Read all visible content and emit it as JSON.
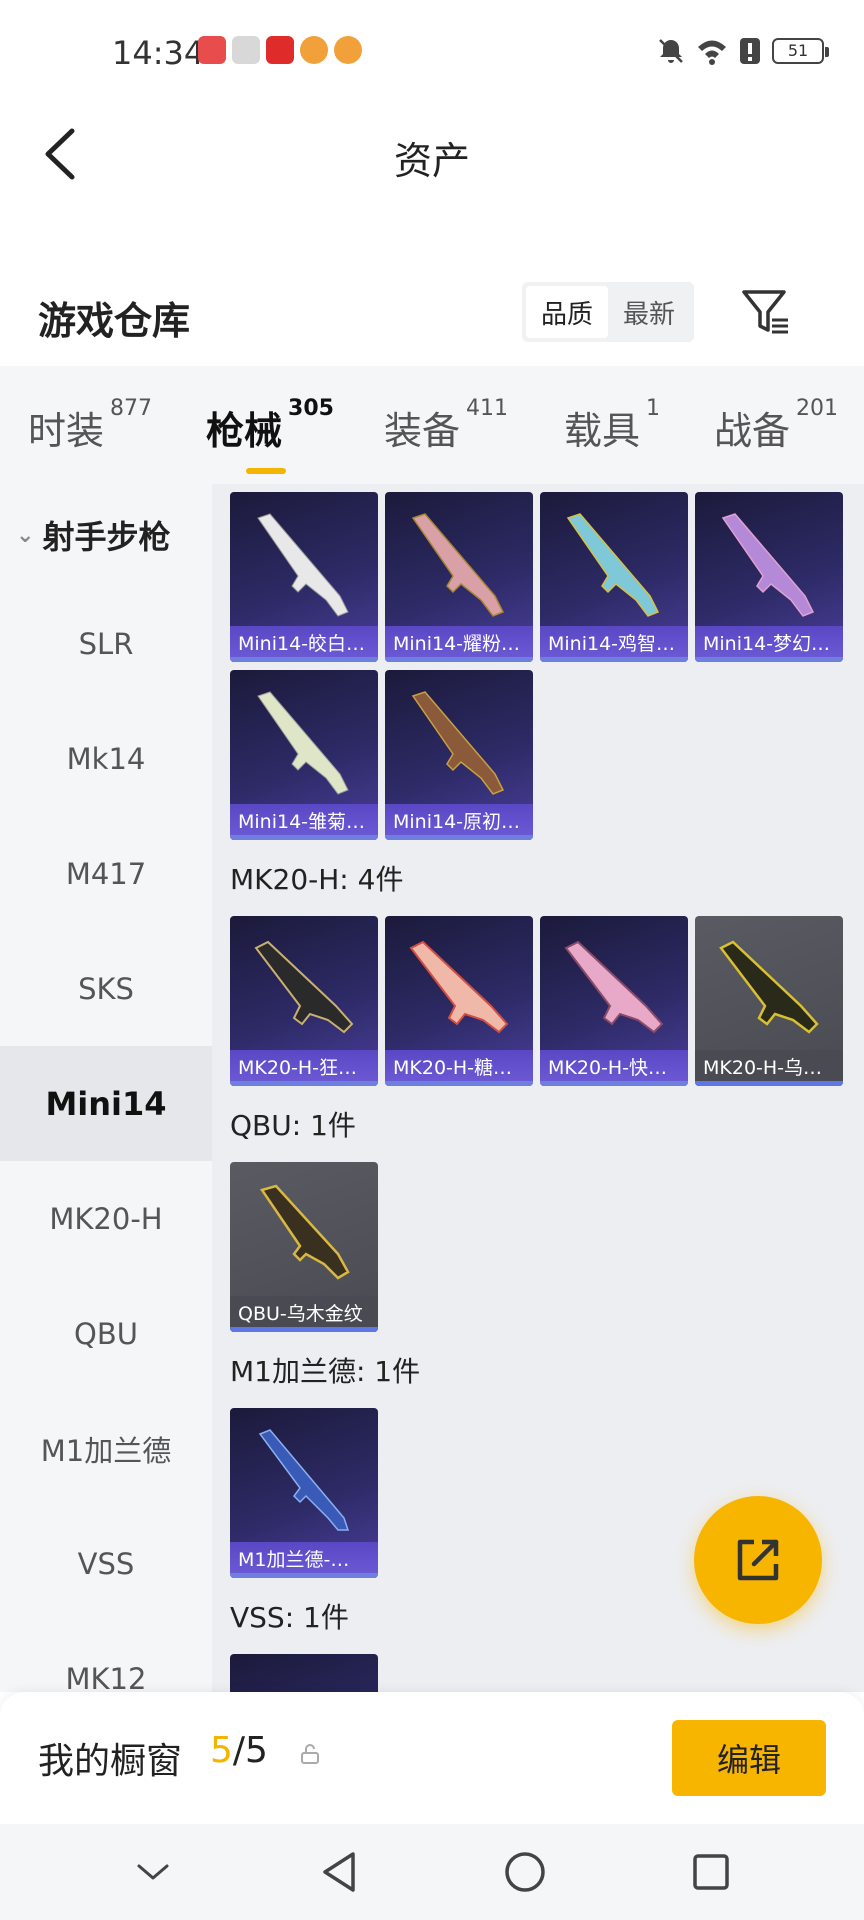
{
  "status": {
    "time": "14:34",
    "battery": "51",
    "notif_colors": [
      "#e84c4c",
      "#cfcfcf",
      "#e02b2b",
      "#f2a03a",
      "#f2a03a"
    ]
  },
  "header": {
    "title": "资产"
  },
  "section": {
    "title": "游戏仓库",
    "sort_options": [
      "品质",
      "最新"
    ]
  },
  "tabs": [
    {
      "label": "时装",
      "count": "877"
    },
    {
      "label": "枪械",
      "count": "305"
    },
    {
      "label": "装备",
      "count": "411"
    },
    {
      "label": "载具",
      "count": "1"
    },
    {
      "label": "战备",
      "count": "201"
    }
  ],
  "sidebar": {
    "group": "射手步枪",
    "items": [
      "SLR",
      "Mk14",
      "M417",
      "SKS",
      "Mini14",
      "MK20-H",
      "QBU",
      "M1加兰德",
      "VSS",
      "MK12"
    ]
  },
  "content": {
    "mini14_cards": [
      "Mini14-皎白…",
      "Mini14-耀粉…",
      "Mini14-鸡智…",
      "Mini14-梦幻…",
      "Mini14-雏菊…",
      "Mini14-原初…"
    ],
    "mk20_label": "MK20-H: 4件",
    "mk20_cards": [
      "MK20-H-狂…",
      "MK20-H-糖…",
      "MK20-H-快…",
      "MK20-H-乌…"
    ],
    "qbu_label": "QBU: 1件",
    "qbu_cards": [
      "QBU-乌木金纹"
    ],
    "m1_label": "M1加兰德: 1件",
    "m1_cards": [
      "M1加兰德-…"
    ],
    "vss_label": "VSS: 1件"
  },
  "bottom": {
    "label": "我的橱窗",
    "current": "5",
    "total": "5",
    "edit": "编辑"
  },
  "colors": {
    "accent": "#f7b500",
    "card_purple": "#2d2a66",
    "caption_purple": "#6d5bd6"
  }
}
